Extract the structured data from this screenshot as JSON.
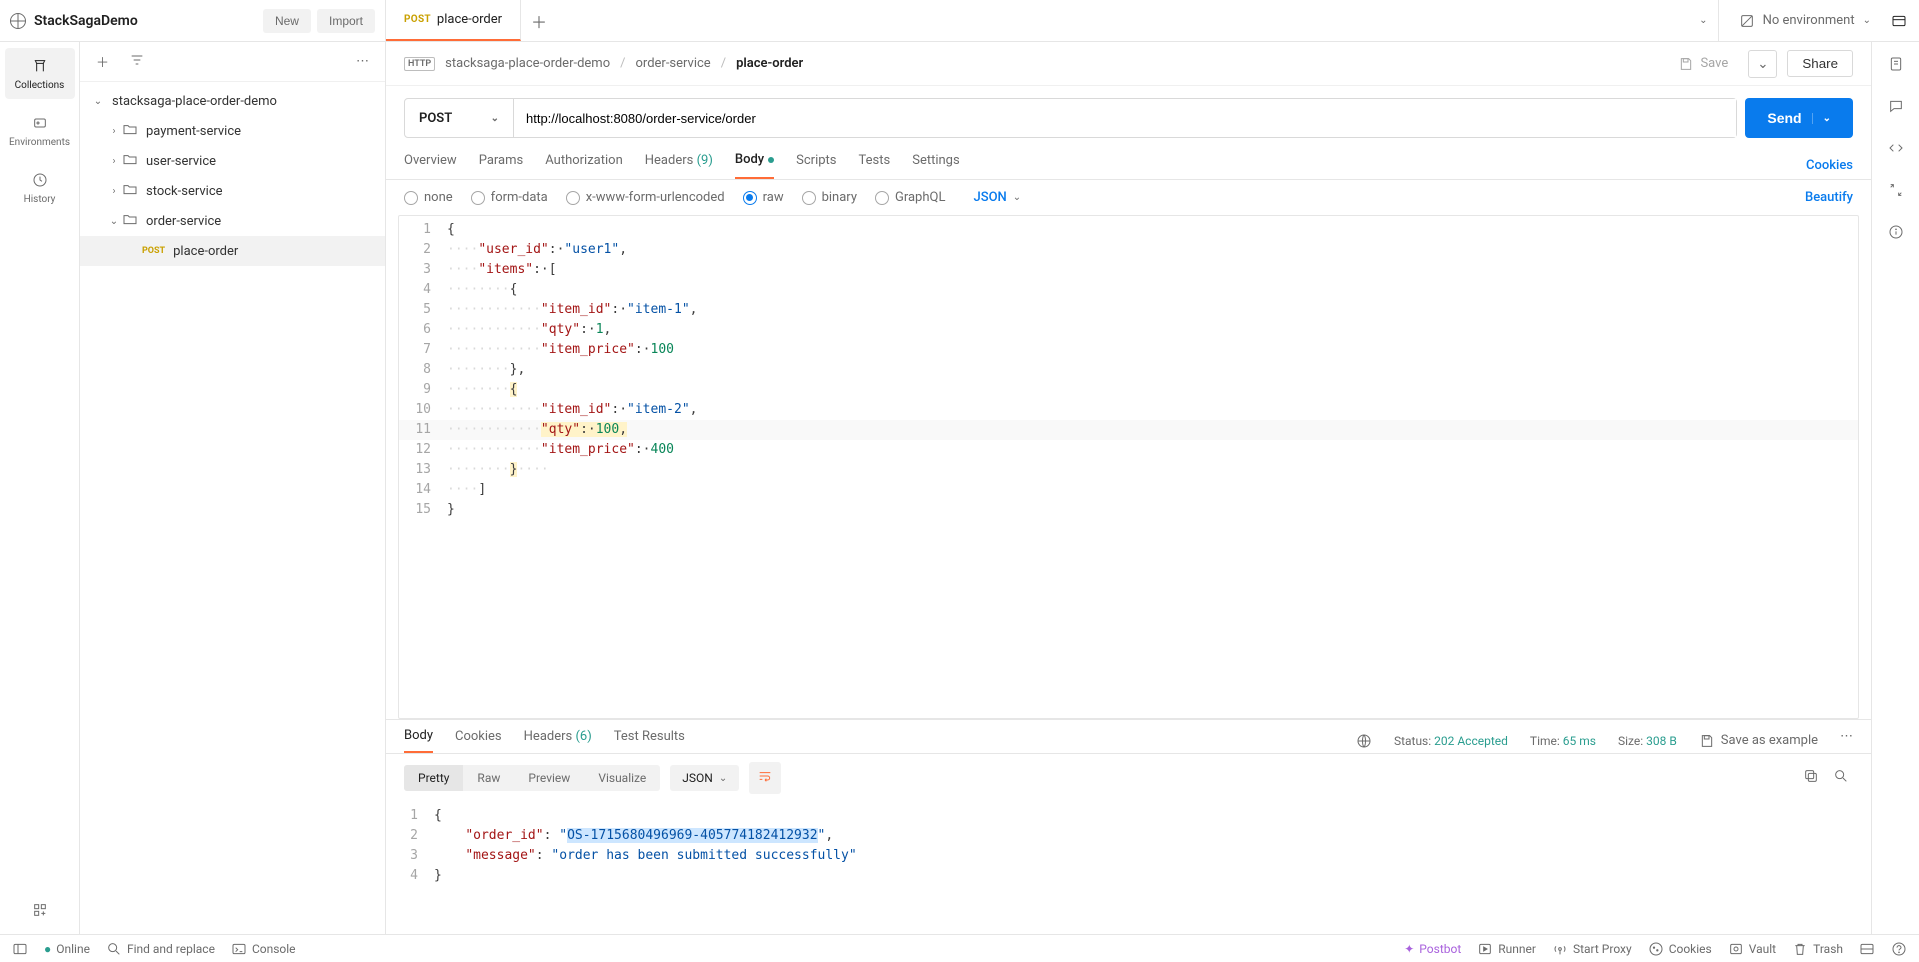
{
  "workspace": {
    "name": "StackSagaDemo"
  },
  "toolbar": {
    "new_label": "New",
    "import_label": "Import"
  },
  "tab": {
    "method": "POST",
    "title": "place-order"
  },
  "env": {
    "label": "No environment"
  },
  "leftrail": {
    "collections": "Collections",
    "environments": "Environments",
    "history": "History"
  },
  "tree": {
    "root": "stacksaga-place-order-demo",
    "folders": {
      "payment": "payment-service",
      "user": "user-service",
      "stock": "stock-service",
      "order": "order-service"
    },
    "request": {
      "method": "POST",
      "name": "place-order"
    }
  },
  "breadcrumb": {
    "http": "HTTP",
    "p1": "stacksaga-place-order-demo",
    "p2": "order-service",
    "p3": "place-order"
  },
  "actions": {
    "save": "Save",
    "share": "Share"
  },
  "request": {
    "method": "POST",
    "url": "http://localhost:8080/order-service/order"
  },
  "send": {
    "label": "Send"
  },
  "reqTabs": {
    "overview": "Overview",
    "params": "Params",
    "auth": "Authorization",
    "headers": "Headers",
    "headers_count": "(9)",
    "body": "Body",
    "scripts": "Scripts",
    "tests": "Tests",
    "settings": "Settings",
    "cookies": "Cookies"
  },
  "bodyTypes": {
    "none": "none",
    "formdata": "form-data",
    "xwww": "x-www-form-urlencoded",
    "raw": "raw",
    "binary": "binary",
    "graphql": "GraphQL",
    "json": "JSON",
    "beautify": "Beautify"
  },
  "reqBody": {
    "l1": "{",
    "l2_k": "\"user_id\"",
    "l2_v": "\"user1\"",
    "l3_k": "\"items\"",
    "l5_k": "\"item_id\"",
    "l5_v": "\"item-1\"",
    "l6_k": "\"qty\"",
    "l6_v": "1",
    "l7_k": "\"item_price\"",
    "l7_v": "100",
    "l10_k": "\"item_id\"",
    "l10_v": "\"item-2\"",
    "l11_k": "\"qty\"",
    "l11_v": "100",
    "l12_k": "\"item_price\"",
    "l12_v": "400"
  },
  "respTabs": {
    "body": "Body",
    "cookies": "Cookies",
    "headers": "Headers",
    "headers_count": "(6)",
    "test": "Test Results"
  },
  "respStatus": {
    "status_l": "Status:",
    "status_v": "202 Accepted",
    "time_l": "Time:",
    "time_v": "65 ms",
    "size_l": "Size:",
    "size_v": "308 B",
    "save_example": "Save as example"
  },
  "respView": {
    "pretty": "Pretty",
    "raw": "Raw",
    "preview": "Preview",
    "visualize": "Visualize",
    "json": "JSON"
  },
  "respBody": {
    "l2_k": "\"order_id\"",
    "l2_v_open": "\"",
    "l2_v_sel": "OS-1715680496969-405774182412932",
    "l2_v_close": "\"",
    "l3_k": "\"message\"",
    "l3_v": "\"order has been submitted successfully\""
  },
  "footer": {
    "online": "Online",
    "find": "Find and replace",
    "console": "Console",
    "postbot": "Postbot",
    "runner": "Runner",
    "proxy": "Start Proxy",
    "cookies": "Cookies",
    "vault": "Vault",
    "trash": "Trash"
  }
}
